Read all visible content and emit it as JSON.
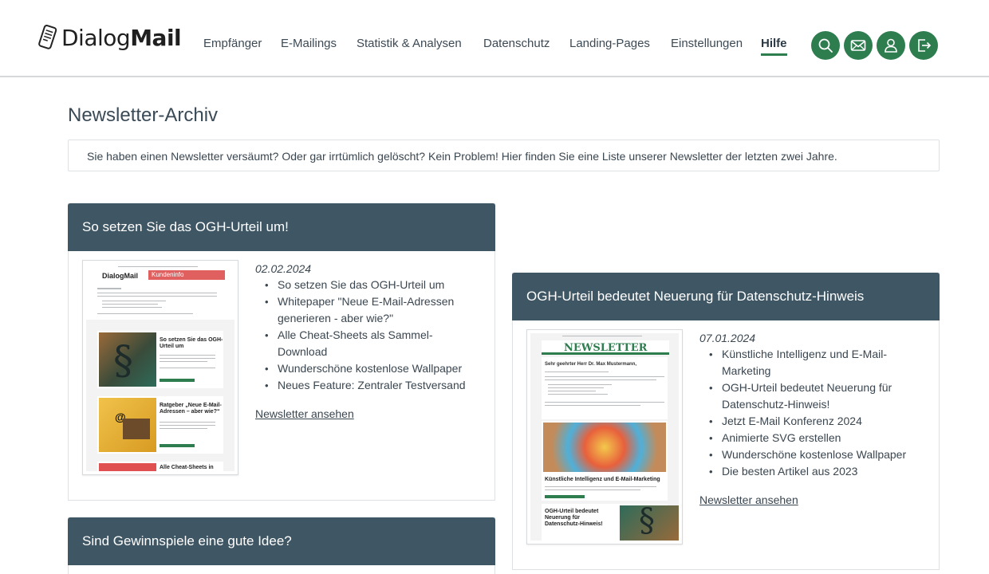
{
  "brand": {
    "logo_text_light": "Dialog",
    "logo_text_bold": "Mail"
  },
  "nav": {
    "items": [
      {
        "label": "Empfänger"
      },
      {
        "label": "E-Mailings"
      },
      {
        "label": "Statistik & Analysen"
      },
      {
        "label": "Datenschutz"
      },
      {
        "label": "Landing-Pages"
      },
      {
        "label": "Einstellungen"
      },
      {
        "label": "Hilfe",
        "active": true
      }
    ],
    "icons": [
      "search-icon",
      "mail-icon",
      "user-icon",
      "logout-icon"
    ]
  },
  "page": {
    "title": "Newsletter-Archiv",
    "intro": "Sie haben einen Newsletter versäumt? Oder gar irrtümlich gelöscht? Kein Problem! Hier finden Sie eine Liste unserer Newsletter der letzten zwei Jahre."
  },
  "newsletters": [
    {
      "title": "So setzen Sie das OGH-Urteil um!",
      "date": "02.02.2024",
      "items": [
        "So setzen Sie das OGH-Urteil um",
        "Whitepaper \"Neue E-Mail-Adressen generieren - aber wie?\"",
        "Alle Cheat-Sheets als Sammel-Download",
        "Wunderschöne kostenlose Wallpaper",
        "Neues Feature: Zentraler Testversand"
      ],
      "link": "Newsletter ansehen",
      "thumb": {
        "brand": "DialogMail",
        "tag": "Kundeninfo",
        "head1": "So setzen Sie das OGH-Urteil um",
        "head2": "Ratgeber „Neue E-Mail-Adressen – aber wie?“",
        "head3": "Alle Cheat-Sheets in neuer Version"
      }
    },
    {
      "title": "OGH-Urteil bedeutet Neuerung für Datenschutz-Hinweis",
      "date": "07.01.2024",
      "items": [
        "Künstliche Intelligenz und E-Mail-Marketing",
        "OGH-Urteil bedeutet Neuerung für Datenschutz-Hinweis!",
        "Jetzt E-Mail Konferenz 2024",
        "Animierte SVG erstellen",
        "Wunderschöne kostenlose Wallpaper",
        "Die besten Artikel aus 2023"
      ],
      "link": "Newsletter ansehen",
      "thumb": {
        "banner": "NEWSLETTER",
        "greeting": "Sehr geehrter Herr Dr. Max Mustermann,",
        "head1": "Künstliche Intelligenz und E-Mail-Marketing",
        "head2": "OGH-Urteil bedeutet Neuerung für Datenschutz-Hinweis!"
      }
    },
    {
      "title": "Sind Gewinnspiele eine gute Idee?"
    }
  ],
  "colors": {
    "accent_green": "#2e7d4f",
    "card_header": "#3f5664"
  }
}
